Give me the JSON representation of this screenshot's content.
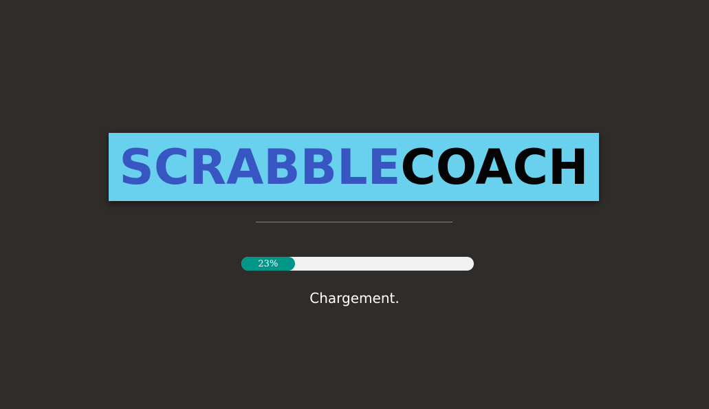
{
  "logo": {
    "part1": "SCRABBLE",
    "part2": "COACH",
    "background_color": "#69d0ee",
    "part1_color": "#3756c1",
    "part2_color": "#040404"
  },
  "progress": {
    "percent": 23,
    "label": "23%",
    "fill_color": "#009688",
    "track_color": "#f1f1f1"
  },
  "status": {
    "text": "Chargement."
  },
  "theme": {
    "background": "#302c29"
  }
}
